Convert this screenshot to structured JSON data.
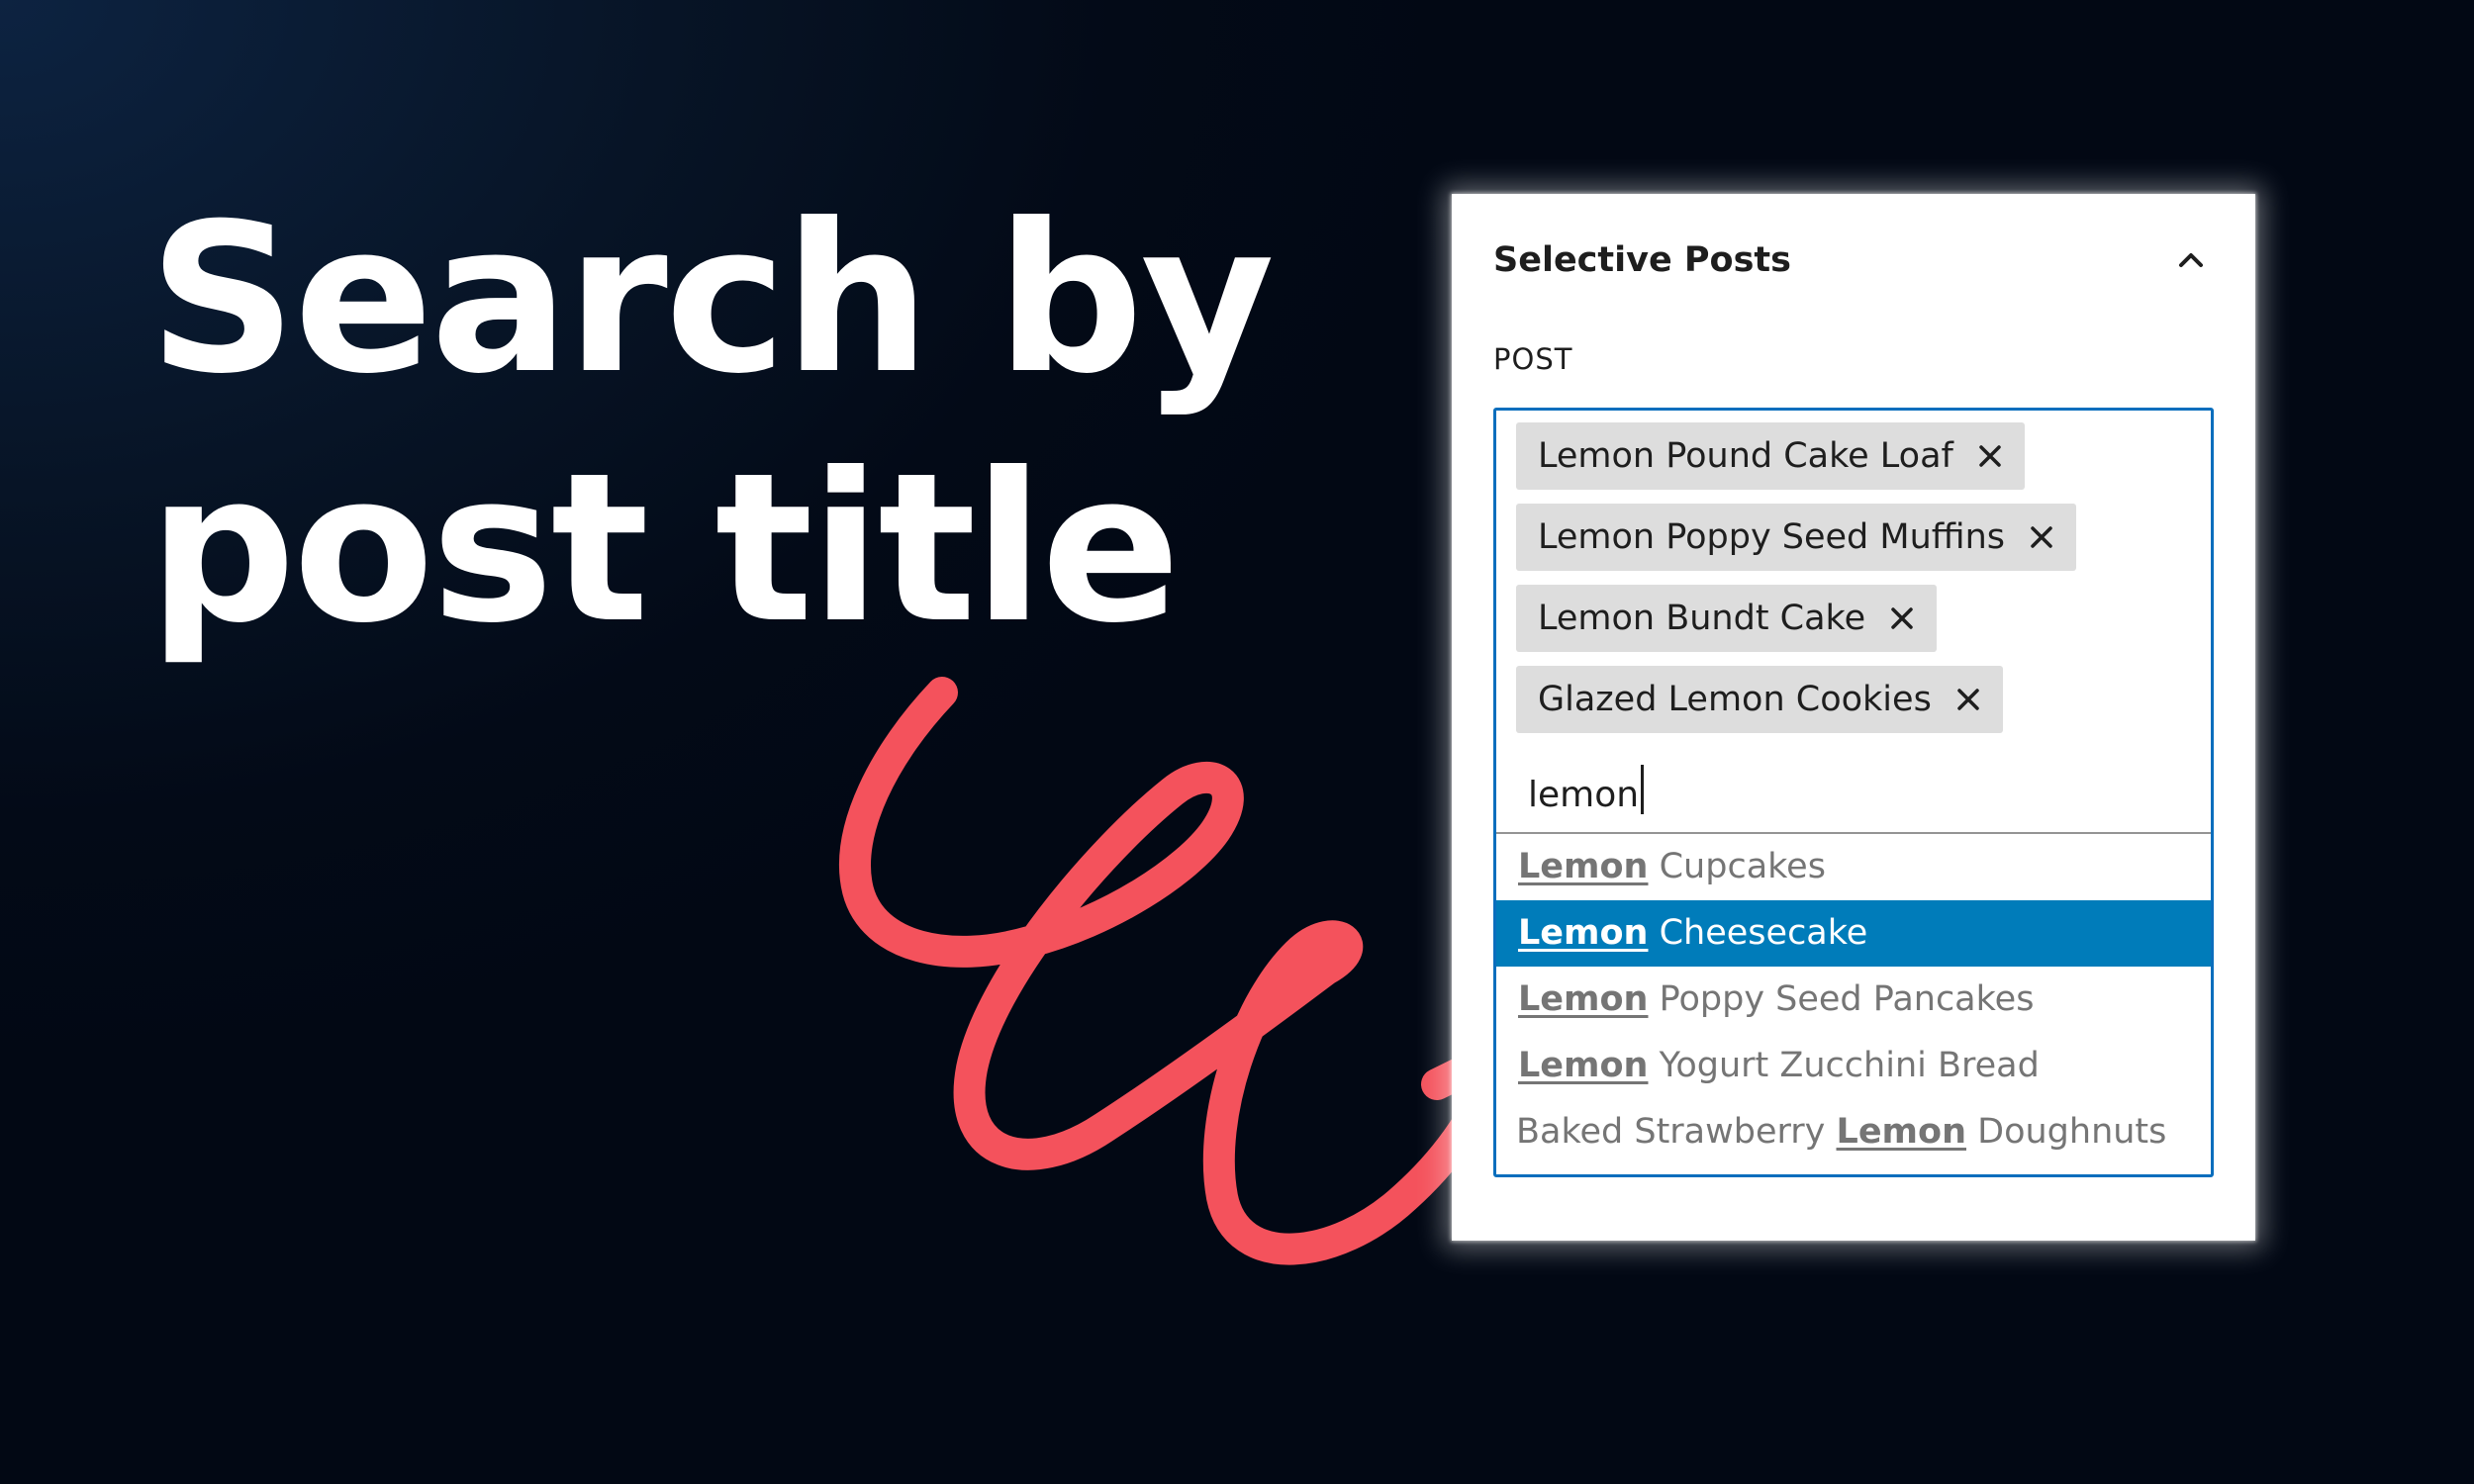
{
  "headline": {
    "line1": "Search by",
    "line2": "post title"
  },
  "panel": {
    "title": "Selective Posts",
    "collapse_icon": "chevron-up-icon",
    "field_label": "POST",
    "tokens": [
      {
        "label": "Lemon Pound Cake Loaf"
      },
      {
        "label": "Lemon Poppy Seed Muffins"
      },
      {
        "label": "Lemon Bundt Cake"
      },
      {
        "label": "Glazed Lemon Cookies"
      }
    ],
    "remove_icon": "close-icon",
    "search_value": "lemon",
    "suggestions": [
      {
        "before": "",
        "match": "Lemon",
        "after": " Cupcakes",
        "selected": false
      },
      {
        "before": "",
        "match": "Lemon",
        "after": " Cheesecake",
        "selected": true
      },
      {
        "before": "",
        "match": "Lemon",
        "after": " Poppy Seed Pancakes",
        "selected": false
      },
      {
        "before": "",
        "match": "Lemon",
        "after": " Yogurt Zucchini Bread",
        "selected": false
      },
      {
        "before": "Baked Strawberry ",
        "match": "Lemon",
        "after": " Doughnuts",
        "selected": false
      }
    ]
  },
  "colors": {
    "accent": "#007cba",
    "focus_border": "#0a6ebd",
    "squiggle": "#f4525c",
    "background": "#030a17"
  }
}
